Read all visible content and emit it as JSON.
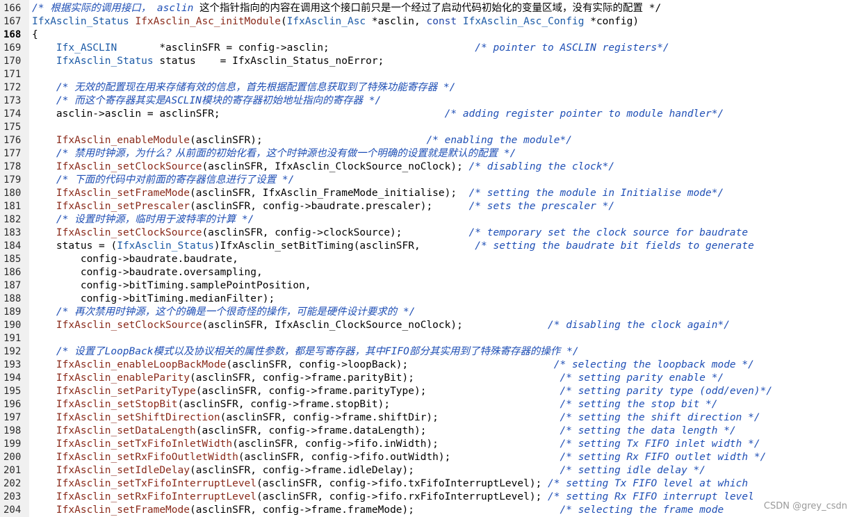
{
  "lines": [
    {
      "n": "166",
      "segs": [
        {
          "c": "cm",
          "t": "/* 根据实际的调用接口， "
        },
        {
          "c": "cm",
          "t": "asclin"
        },
        {
          "c": "cmz",
          "t": " 这个指针指向的内容在调用这个接口前只是一个经过了启动代码初始化的变量区域，没有实际的配置 */"
        }
      ]
    },
    {
      "n": "167",
      "segs": [
        {
          "c": "ty",
          "t": "IfxAsclin_Status"
        },
        {
          "c": "id",
          "t": " "
        },
        {
          "c": "fn",
          "t": "IfxAsclin_Asc_initModule"
        },
        {
          "c": "id",
          "t": "("
        },
        {
          "c": "ty",
          "t": "IfxAsclin_Asc"
        },
        {
          "c": "id",
          "t": " *asclin, "
        },
        {
          "c": "kw",
          "t": "const"
        },
        {
          "c": "id",
          "t": " "
        },
        {
          "c": "ty",
          "t": "IfxAsclin_Asc_Config"
        },
        {
          "c": "id",
          "t": " *config)"
        }
      ]
    },
    {
      "n": "168",
      "cur": true,
      "segs": [
        {
          "c": "id",
          "t": "{"
        }
      ]
    },
    {
      "n": "169",
      "segs": [
        {
          "c": "id",
          "t": "    "
        },
        {
          "c": "ty",
          "t": "Ifx_ASCLIN"
        },
        {
          "c": "id",
          "t": "       *asclinSFR = config->asclin;                        "
        },
        {
          "c": "cm",
          "t": "/* pointer to ASCLIN registers*/"
        }
      ]
    },
    {
      "n": "170",
      "segs": [
        {
          "c": "id",
          "t": "    "
        },
        {
          "c": "ty",
          "t": "IfxAsclin_Status"
        },
        {
          "c": "id",
          "t": " status    = IfxAsclin_Status_noError;"
        }
      ]
    },
    {
      "n": "171",
      "segs": []
    },
    {
      "n": "172",
      "segs": [
        {
          "c": "id",
          "t": "    "
        },
        {
          "c": "cm",
          "t": "/* 无效的配置现在用来存储有效的信息，首先根据配置信息获取到了特殊功能寄存器 */"
        }
      ]
    },
    {
      "n": "173",
      "segs": [
        {
          "c": "id",
          "t": "    "
        },
        {
          "c": "cm",
          "t": "/* 而这个寄存器其实是ASCLIN模块的寄存器初始地址指向的寄存器 */"
        }
      ]
    },
    {
      "n": "174",
      "segs": [
        {
          "c": "id",
          "t": "    asclin->asclin = asclinSFR;                                     "
        },
        {
          "c": "cm",
          "t": "/* adding register pointer to module handler*/"
        }
      ]
    },
    {
      "n": "175",
      "segs": []
    },
    {
      "n": "176",
      "segs": [
        {
          "c": "id",
          "t": "    "
        },
        {
          "c": "fn",
          "t": "IfxAsclin_enableModule"
        },
        {
          "c": "id",
          "t": "(asclinSFR);                           "
        },
        {
          "c": "cm",
          "t": "/* enabling the module*/"
        }
      ]
    },
    {
      "n": "177",
      "segs": [
        {
          "c": "id",
          "t": "    "
        },
        {
          "c": "cm",
          "t": "/* 禁用时钟源，为什么？从前面的初始化看，这个时钟源也没有做一个明确的设置就是默认的配置 */"
        }
      ]
    },
    {
      "n": "178",
      "segs": [
        {
          "c": "id",
          "t": "    "
        },
        {
          "c": "fn",
          "t": "IfxAsclin_setClockSource"
        },
        {
          "c": "id",
          "t": "(asclinSFR, IfxAsclin_ClockSource_noClock); "
        },
        {
          "c": "cm",
          "t": "/* disabling the clock*/"
        }
      ]
    },
    {
      "n": "179",
      "segs": [
        {
          "c": "id",
          "t": "    "
        },
        {
          "c": "cm",
          "t": "/* 下面的代码中对前面的寄存器信息进行了设置 */"
        }
      ]
    },
    {
      "n": "180",
      "segs": [
        {
          "c": "id",
          "t": "    "
        },
        {
          "c": "fn",
          "t": "IfxAsclin_setFrameMode"
        },
        {
          "c": "id",
          "t": "(asclinSFR, IfxAsclin_FrameMode_initialise);  "
        },
        {
          "c": "cm",
          "t": "/* setting the module in Initialise mode*/"
        }
      ]
    },
    {
      "n": "181",
      "segs": [
        {
          "c": "id",
          "t": "    "
        },
        {
          "c": "fn",
          "t": "IfxAsclin_setPrescaler"
        },
        {
          "c": "id",
          "t": "(asclinSFR, config->baudrate.prescaler);      "
        },
        {
          "c": "cm",
          "t": "/* sets the prescaler */"
        }
      ]
    },
    {
      "n": "182",
      "segs": [
        {
          "c": "id",
          "t": "    "
        },
        {
          "c": "cm",
          "t": "/* 设置时钟源，临时用于波特率的计算 */"
        }
      ]
    },
    {
      "n": "183",
      "segs": [
        {
          "c": "id",
          "t": "    "
        },
        {
          "c": "fn",
          "t": "IfxAsclin_setClockSource"
        },
        {
          "c": "id",
          "t": "(asclinSFR, config->clockSource);           "
        },
        {
          "c": "cm",
          "t": "/* temporary set the clock source for baudrate"
        }
      ]
    },
    {
      "n": "184",
      "segs": [
        {
          "c": "id",
          "t": "    status = ("
        },
        {
          "c": "ty",
          "t": "IfxAsclin_Status"
        },
        {
          "c": "id",
          "t": ")IfxAsclin_setBitTiming(asclinSFR,         "
        },
        {
          "c": "cm",
          "t": "/* setting the baudrate bit fields to generate"
        }
      ]
    },
    {
      "n": "185",
      "segs": [
        {
          "c": "id",
          "t": "        config->baudrate.baudrate,"
        }
      ]
    },
    {
      "n": "186",
      "segs": [
        {
          "c": "id",
          "t": "        config->baudrate.oversampling,"
        }
      ]
    },
    {
      "n": "187",
      "segs": [
        {
          "c": "id",
          "t": "        config->bitTiming.samplePointPosition,"
        }
      ]
    },
    {
      "n": "188",
      "segs": [
        {
          "c": "id",
          "t": "        config->bitTiming.medianFilter);"
        }
      ]
    },
    {
      "n": "189",
      "segs": [
        {
          "c": "id",
          "t": "    "
        },
        {
          "c": "cm",
          "t": "/* 再次禁用时钟源，这个的确是一个很奇怪的操作，可能是硬件设计要求的 */"
        }
      ]
    },
    {
      "n": "190",
      "segs": [
        {
          "c": "id",
          "t": "    "
        },
        {
          "c": "fn",
          "t": "IfxAsclin_setClockSource"
        },
        {
          "c": "id",
          "t": "(asclinSFR, IfxAsclin_ClockSource_noClock);              "
        },
        {
          "c": "cm",
          "t": "/* disabling the clock again*/"
        }
      ]
    },
    {
      "n": "191",
      "segs": []
    },
    {
      "n": "192",
      "segs": [
        {
          "c": "id",
          "t": "    "
        },
        {
          "c": "cm",
          "t": "/* 设置了LoopBack模式以及协议相关的属性参数，都是写寄存器，其中FIFO部分其实用到了特殊寄存器的操作 */"
        }
      ]
    },
    {
      "n": "193",
      "segs": [
        {
          "c": "id",
          "t": "    "
        },
        {
          "c": "fn",
          "t": "IfxAsclin_enableLoopBackMode"
        },
        {
          "c": "id",
          "t": "(asclinSFR, config->loopBack);                        "
        },
        {
          "c": "cm",
          "t": "/* selecting the loopback mode */"
        }
      ]
    },
    {
      "n": "194",
      "segs": [
        {
          "c": "id",
          "t": "    "
        },
        {
          "c": "fn",
          "t": "IfxAsclin_enableParity"
        },
        {
          "c": "id",
          "t": "(asclinSFR, config->frame.parityBit);                        "
        },
        {
          "c": "cm",
          "t": "/* setting parity enable */"
        }
      ]
    },
    {
      "n": "195",
      "segs": [
        {
          "c": "id",
          "t": "    "
        },
        {
          "c": "fn",
          "t": "IfxAsclin_setParityType"
        },
        {
          "c": "id",
          "t": "(asclinSFR, config->frame.parityType);                      "
        },
        {
          "c": "cm",
          "t": "/* setting parity type (odd/even)*/"
        }
      ]
    },
    {
      "n": "196",
      "segs": [
        {
          "c": "id",
          "t": "    "
        },
        {
          "c": "fn",
          "t": "IfxAsclin_setStopBit"
        },
        {
          "c": "id",
          "t": "(asclinSFR, config->frame.stopBit);                            "
        },
        {
          "c": "cm",
          "t": "/* setting the stop bit */"
        }
      ]
    },
    {
      "n": "197",
      "segs": [
        {
          "c": "id",
          "t": "    "
        },
        {
          "c": "fn",
          "t": "IfxAsclin_setShiftDirection"
        },
        {
          "c": "id",
          "t": "(asclinSFR, config->frame.shiftDir);                    "
        },
        {
          "c": "cm",
          "t": "/* setting the shift direction */"
        }
      ]
    },
    {
      "n": "198",
      "segs": [
        {
          "c": "id",
          "t": "    "
        },
        {
          "c": "fn",
          "t": "IfxAsclin_setDataLength"
        },
        {
          "c": "id",
          "t": "(asclinSFR, config->frame.dataLength);                      "
        },
        {
          "c": "cm",
          "t": "/* setting the data length */"
        }
      ]
    },
    {
      "n": "199",
      "segs": [
        {
          "c": "id",
          "t": "    "
        },
        {
          "c": "fn",
          "t": "IfxAsclin_setTxFifoInletWidth"
        },
        {
          "c": "id",
          "t": "(asclinSFR, config->fifo.inWidth);                    "
        },
        {
          "c": "cm",
          "t": "/* setting Tx FIFO inlet width */"
        }
      ]
    },
    {
      "n": "200",
      "segs": [
        {
          "c": "id",
          "t": "    "
        },
        {
          "c": "fn",
          "t": "IfxAsclin_setRxFifoOutletWidth"
        },
        {
          "c": "id",
          "t": "(asclinSFR, config->fifo.outWidth);                  "
        },
        {
          "c": "cm",
          "t": "/* setting Rx FIFO outlet width */"
        }
      ]
    },
    {
      "n": "201",
      "segs": [
        {
          "c": "id",
          "t": "    "
        },
        {
          "c": "fn",
          "t": "IfxAsclin_setIdleDelay"
        },
        {
          "c": "id",
          "t": "(asclinSFR, config->frame.idleDelay);                        "
        },
        {
          "c": "cm",
          "t": "/* setting idle delay */"
        }
      ]
    },
    {
      "n": "202",
      "segs": [
        {
          "c": "id",
          "t": "    "
        },
        {
          "c": "fn",
          "t": "IfxAsclin_setTxFifoInterruptLevel"
        },
        {
          "c": "id",
          "t": "(asclinSFR, config->fifo.txFifoInterruptLevel); "
        },
        {
          "c": "cm",
          "t": "/* setting Tx FIFO level at which"
        }
      ]
    },
    {
      "n": "203",
      "segs": [
        {
          "c": "id",
          "t": "    "
        },
        {
          "c": "fn",
          "t": "IfxAsclin_setRxFifoInterruptLevel"
        },
        {
          "c": "id",
          "t": "(asclinSFR, config->fifo.rxFifoInterruptLevel); "
        },
        {
          "c": "cm",
          "t": "/* setting Rx FIFO interrupt level"
        }
      ]
    },
    {
      "n": "204",
      "segs": [
        {
          "c": "id",
          "t": "    "
        },
        {
          "c": "fn",
          "t": "IfxAsclin_setFrameMode"
        },
        {
          "c": "id",
          "t": "(asclinSFR, config->frame.frameMode);                        "
        },
        {
          "c": "cm",
          "t": "/* selecting the frame mode"
        }
      ]
    },
    {
      "n": "205",
      "segs": []
    }
  ],
  "watermark": "CSDN @grey_csdn",
  "colors": {
    "background": "#ffffff",
    "gutter": "#f0f0f0",
    "comment": "#1f4fb5",
    "type": "#1c5aa6",
    "function": "#8a2a1a"
  }
}
